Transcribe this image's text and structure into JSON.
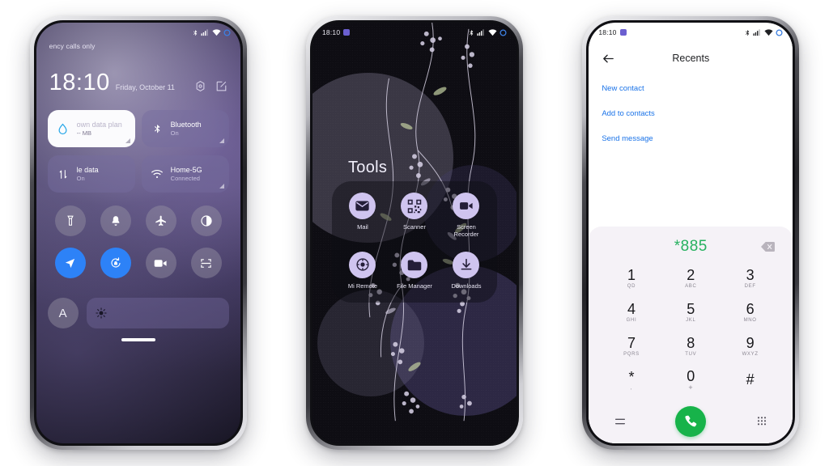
{
  "colors": {
    "accent_blue": "#2d82f7",
    "link_blue": "#1a73e8",
    "call_green": "#17b34a",
    "number_green": "#26b15f",
    "folder_icon_bg": "#cfc4ef",
    "water_drop_blue": "#2aa8e8"
  },
  "phone1": {
    "name": "lock-screen-quick-settings",
    "statusbar": {
      "carrier": "ency calls only",
      "icons": [
        "bluetooth-icon",
        "signal-bars-icon",
        "wifi-icon",
        "circle-indicator-icon"
      ]
    },
    "clock": {
      "time": "18:10",
      "date": "Friday, October 11",
      "icons": [
        "settings-gear-icon",
        "edit-pencil-icon"
      ]
    },
    "big_tiles": [
      {
        "title": "own data plan",
        "sub": "-- MB",
        "icon": "water-drop-icon",
        "style": "light"
      },
      {
        "title": "Bluetooth",
        "sub": "On",
        "icon": "bluetooth-icon",
        "style": "dark"
      },
      {
        "title": "le data",
        "sub": "On",
        "icon": "mobile-data-arrows-icon",
        "style": "dark"
      },
      {
        "title": "Home-5G",
        "sub": "Connected",
        "icon": "wifi-icon",
        "style": "dark"
      }
    ],
    "round_tiles": [
      {
        "icon": "flashlight-icon",
        "state": "off"
      },
      {
        "icon": "bell-icon",
        "state": "off"
      },
      {
        "icon": "airplane-icon",
        "state": "off"
      },
      {
        "icon": "dark-mode-contrast-icon",
        "state": "off"
      },
      {
        "icon": "location-arrow-icon",
        "state": "on"
      },
      {
        "icon": "auto-rotate-icon",
        "state": "on"
      },
      {
        "icon": "screen-record-video-icon",
        "state": "off"
      },
      {
        "icon": "screenshot-frame-icon",
        "state": "off"
      }
    ],
    "brightness": {
      "auto_label": "A",
      "icon": "brightness-sun-icon"
    }
  },
  "phone2": {
    "name": "home-screen-tools-folder",
    "statusbar": {
      "time": "18:10",
      "badge": "notification-badge",
      "icons": [
        "bluetooth-icon",
        "signal-bars-icon",
        "wifi-icon",
        "circle-indicator-icon"
      ]
    },
    "folder_title": "Tools",
    "apps": [
      {
        "label": "Mail",
        "icon": "envelope-icon"
      },
      {
        "label": "Scanner",
        "icon": "qr-code-icon"
      },
      {
        "label": "Screen Recorder",
        "icon": "video-camera-icon"
      },
      {
        "label": "Mi Remote",
        "icon": "remote-control-icon"
      },
      {
        "label": "File Manager",
        "icon": "folder-icon"
      },
      {
        "label": "Downloads",
        "icon": "download-arrow-icon"
      }
    ]
  },
  "phone3": {
    "name": "dialer-recents",
    "statusbar": {
      "time": "18:10",
      "badge": "notification-badge",
      "icons": [
        "bluetooth-icon",
        "signal-bars-icon",
        "wifi-icon",
        "circle-indicator-icon"
      ]
    },
    "header": {
      "title": "Recents",
      "back_icon": "back-arrow-icon"
    },
    "links": [
      "New contact",
      "Add to contacts",
      "Send message"
    ],
    "dialpad": {
      "number": "*885",
      "backspace_icon": "backspace-icon",
      "keys": [
        {
          "digit": "1",
          "letters": "QD"
        },
        {
          "digit": "2",
          "letters": "ABC"
        },
        {
          "digit": "3",
          "letters": "DEF"
        },
        {
          "digit": "4",
          "letters": "GHI"
        },
        {
          "digit": "5",
          "letters": "JKL"
        },
        {
          "digit": "6",
          "letters": "MNO"
        },
        {
          "digit": "7",
          "letters": "PQRS"
        },
        {
          "digit": "8",
          "letters": "TUV"
        },
        {
          "digit": "9",
          "letters": "WXYZ"
        },
        {
          "digit": "*",
          "letters": ","
        },
        {
          "digit": "0",
          "letters": "+"
        },
        {
          "digit": "#",
          "letters": ""
        }
      ],
      "bottom_bar": [
        "menu-lines-icon",
        "call-button",
        "keypad-grid-icon"
      ]
    }
  }
}
